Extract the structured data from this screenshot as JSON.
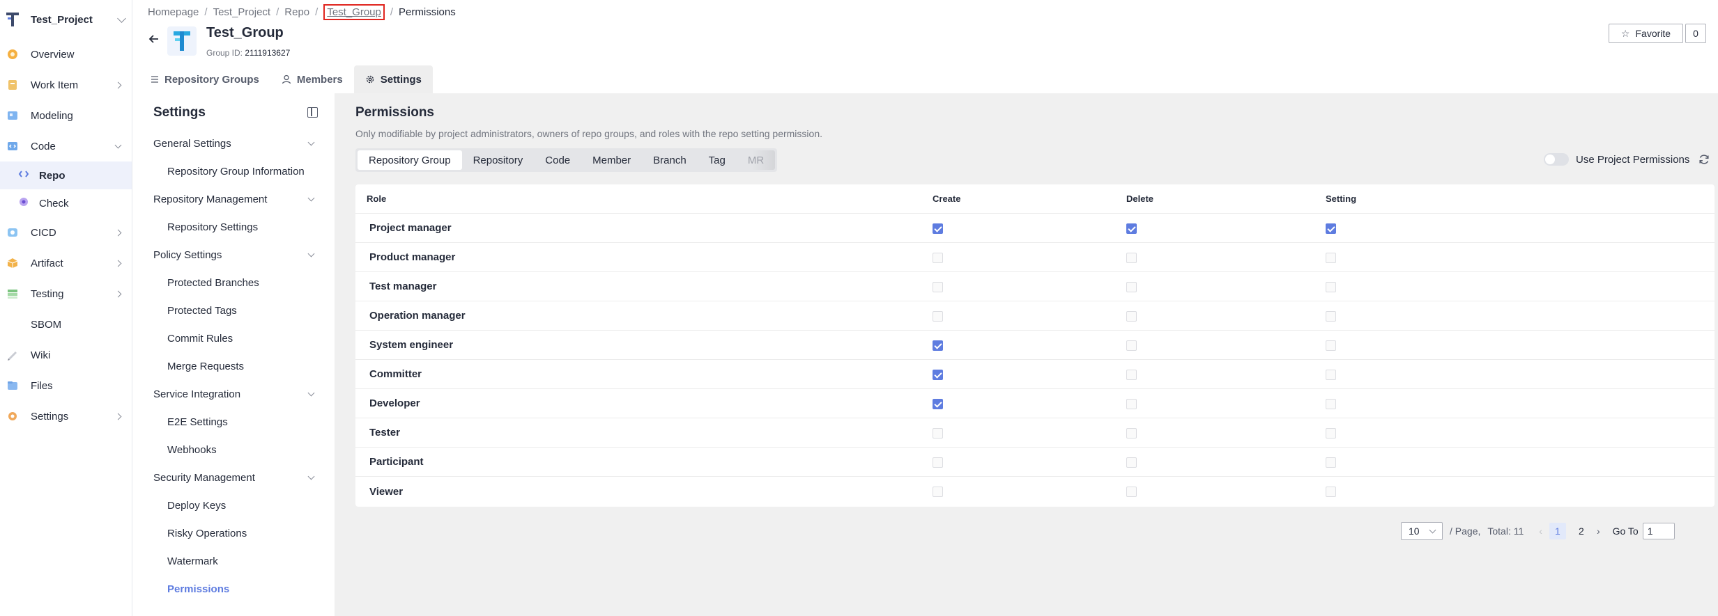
{
  "project": {
    "name": "Test_Project"
  },
  "nav": {
    "items": [
      {
        "label": "Overview"
      },
      {
        "label": "Work Item"
      },
      {
        "label": "Modeling"
      },
      {
        "label": "Code"
      },
      {
        "label": "Repo"
      },
      {
        "label": "Check"
      },
      {
        "label": "CICD"
      },
      {
        "label": "Artifact"
      },
      {
        "label": "Testing"
      },
      {
        "label": "SBOM"
      },
      {
        "label": "Wiki"
      },
      {
        "label": "Files"
      },
      {
        "label": "Settings"
      }
    ]
  },
  "breadcrumb": [
    "Homepage",
    "Test_Project",
    "Repo",
    "Test_Group",
    "Permissions"
  ],
  "group": {
    "title": "Test_Group",
    "id_label": "Group ID:",
    "id_value": "2111913627"
  },
  "favorite": {
    "label": "Favorite",
    "count": "0"
  },
  "tabs": [
    {
      "label": "Repository Groups"
    },
    {
      "label": "Members"
    },
    {
      "label": "Settings"
    }
  ],
  "settings_menu": {
    "title": "Settings",
    "groups": [
      {
        "label": "General Settings",
        "items": [
          "Repository Group Information"
        ]
      },
      {
        "label": "Repository Management",
        "items": [
          "Repository Settings"
        ]
      },
      {
        "label": "Policy Settings",
        "items": [
          "Protected Branches",
          "Protected Tags",
          "Commit Rules",
          "Merge Requests"
        ]
      },
      {
        "label": "Service Integration",
        "items": [
          "E2E Settings",
          "Webhooks"
        ]
      },
      {
        "label": "Security Management",
        "items": [
          "Deploy Keys",
          "Risky Operations",
          "Watermark",
          "Permissions"
        ]
      }
    ]
  },
  "permissions": {
    "title": "Permissions",
    "description": "Only modifiable by project administrators, owners of repo groups, and roles with the repo setting permission.",
    "segments": [
      "Repository Group",
      "Repository",
      "Code",
      "Member",
      "Branch",
      "Tag",
      "MR"
    ],
    "toggle_label": "Use Project Permissions",
    "columns": [
      "Role",
      "Create",
      "Delete",
      "Setting"
    ],
    "rows": [
      {
        "role": "Project manager",
        "create": "checked",
        "delete": "checked",
        "setting": "checked"
      },
      {
        "role": "Product manager",
        "create": "disabled",
        "delete": "disabled",
        "setting": "disabled"
      },
      {
        "role": "Test manager",
        "create": "disabled",
        "delete": "disabled",
        "setting": "disabled"
      },
      {
        "role": "Operation manager",
        "create": "disabled",
        "delete": "disabled",
        "setting": "disabled"
      },
      {
        "role": "System engineer",
        "create": "checked",
        "delete": "disabled",
        "setting": "disabled"
      },
      {
        "role": "Committer",
        "create": "checked",
        "delete": "disabled",
        "setting": "disabled"
      },
      {
        "role": "Developer",
        "create": "checked",
        "delete": "disabled",
        "setting": "disabled"
      },
      {
        "role": "Tester",
        "create": "disabled",
        "delete": "disabled",
        "setting": "disabled"
      },
      {
        "role": "Participant",
        "create": "disabled",
        "delete": "disabled",
        "setting": "disabled"
      },
      {
        "role": "Viewer",
        "create": "disabled",
        "delete": "disabled",
        "setting": "disabled"
      }
    ]
  },
  "pagination": {
    "page_size": "10",
    "per_page_label": "/ Page,",
    "total_label": "Total: 11",
    "pages": [
      "1",
      "2"
    ],
    "goto_label": "Go To",
    "goto_value": "1"
  },
  "colors": {
    "accent": "#5e7ce0",
    "highlight_border": "#e0251f"
  }
}
